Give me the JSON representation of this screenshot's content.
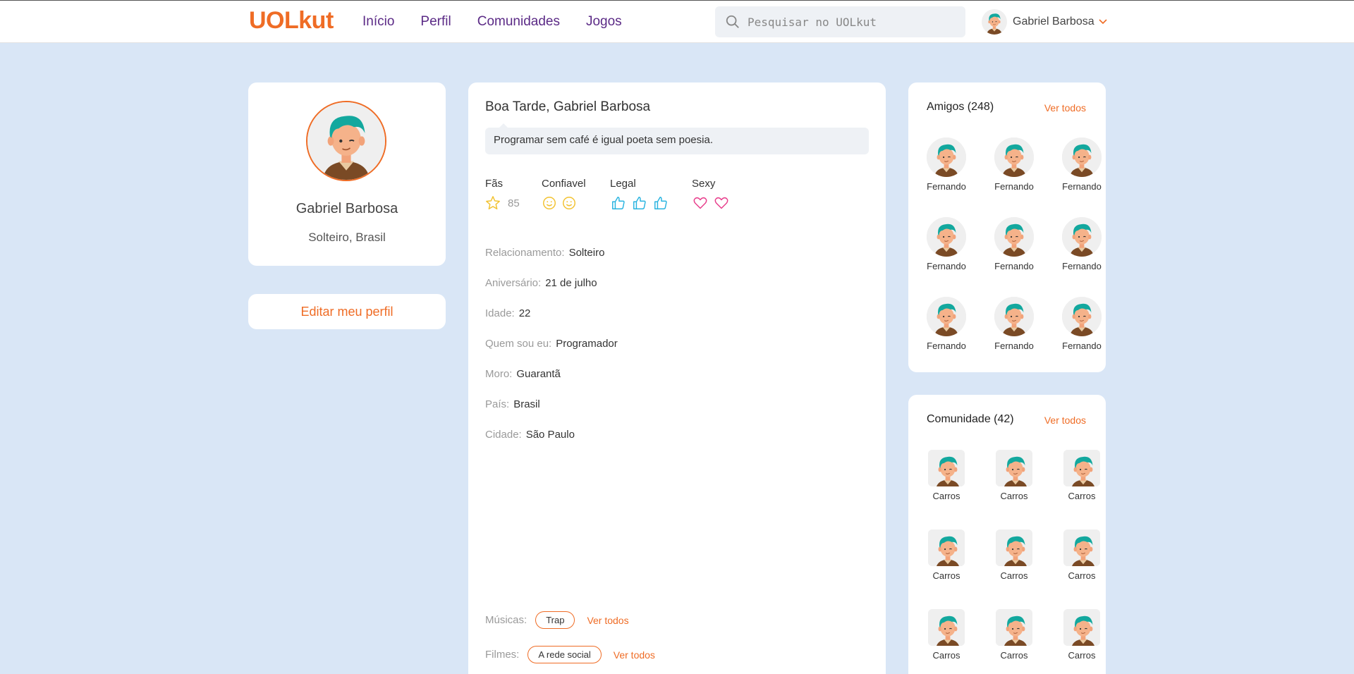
{
  "header": {
    "logo": "UOLkut",
    "nav": [
      "Início",
      "Perfil",
      "Comunidades",
      "Jogos"
    ],
    "search_placeholder": "Pesquisar no UOLkut",
    "user_name": "Gabriel Barbosa"
  },
  "profile": {
    "name": "Gabriel Barbosa",
    "status": "Solteiro, Brasil",
    "edit_label": "Editar meu perfil"
  },
  "main": {
    "greeting": "Boa Tarde, Gabriel Barbosa",
    "quote": "Programar sem café é igual poeta sem poesia.",
    "stats": {
      "fans_label": "Fãs",
      "fans_count": "85",
      "trust_label": "Confiavel",
      "cool_label": "Legal",
      "sexy_label": "Sexy"
    },
    "info": [
      {
        "key": "Relacionamento:",
        "value": "Solteiro"
      },
      {
        "key": "Aniversário:",
        "value": "21 de julho"
      },
      {
        "key": "Idade:",
        "value": "22"
      },
      {
        "key": "Quem sou eu:",
        "value": "Programador"
      },
      {
        "key": "Moro:",
        "value": "Guarantã"
      },
      {
        "key": "País:",
        "value": "Brasil"
      },
      {
        "key": "Cidade:",
        "value": "São Paulo"
      }
    ],
    "music_label": "Músicas:",
    "music_tag": "Trap",
    "movies_label": "Filmes:",
    "movies_tag": "A rede social",
    "see_all": "Ver todos"
  },
  "friends": {
    "title": "Amigos (248)",
    "see_all": "Ver todos",
    "items": [
      "Fernando",
      "Fernando",
      "Fernando",
      "Fernando",
      "Fernando",
      "Fernando",
      "Fernando",
      "Fernando",
      "Fernando"
    ]
  },
  "communities": {
    "title": "Comunidade (42)",
    "see_all": "Ver todos",
    "items": [
      "Carros",
      "Carros",
      "Carros",
      "Carros",
      "Carros",
      "Carros",
      "Carros",
      "Carros",
      "Carros"
    ]
  },
  "colors": {
    "accent": "#ef6c25",
    "nav": "#5b2a86",
    "background": "#d9e6f6"
  }
}
